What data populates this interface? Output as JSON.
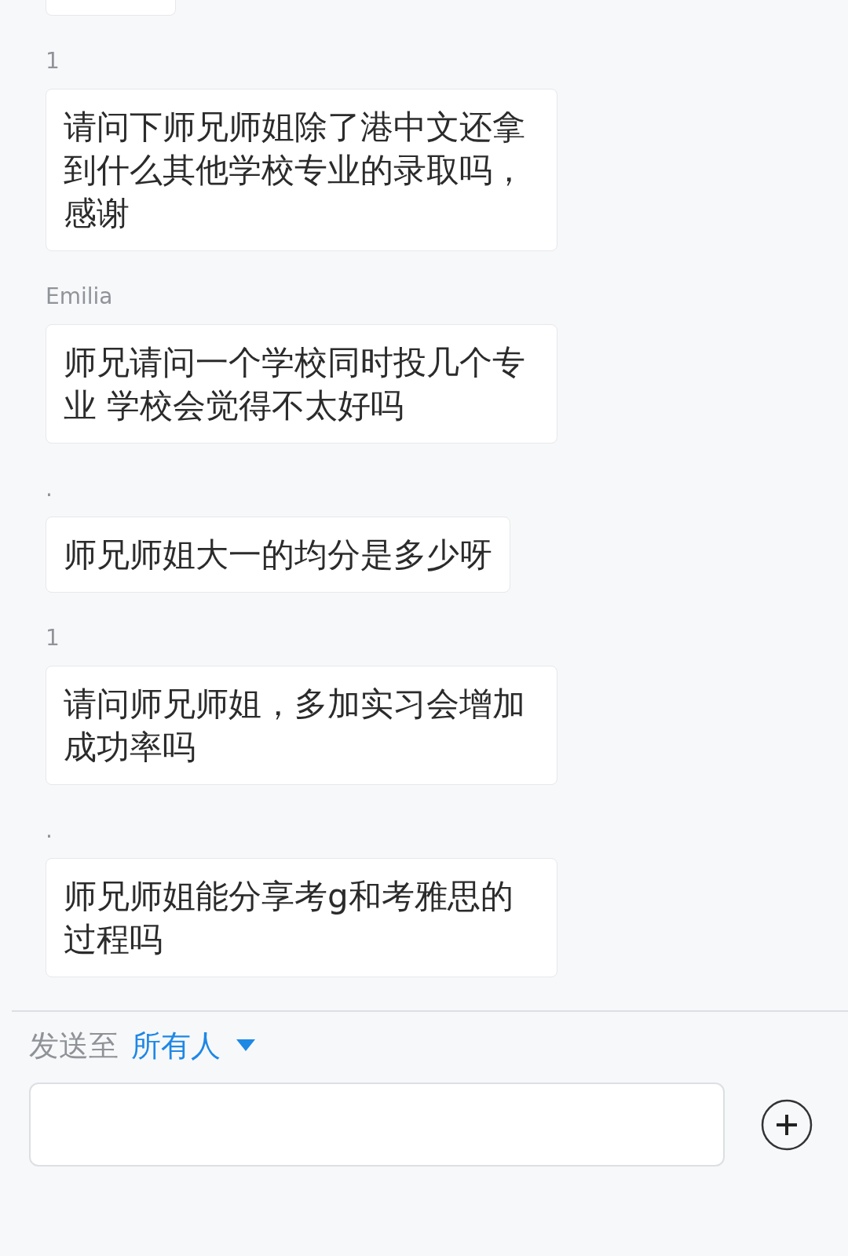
{
  "partial_message_above": true,
  "messages": [
    {
      "sender": "1",
      "text": "请问下师兄师姐除了港中文还拿到什么其他学校专业的录取吗，感谢"
    },
    {
      "sender": "Emilia",
      "text": "师兄请问一个学校同时投几个专业 学校会觉得不太好吗"
    },
    {
      "sender": ".",
      "text": "师兄师姐大一的均分是多少呀"
    },
    {
      "sender": "1",
      "text": "请问师兄师姐，多加实习会增加成功率吗"
    },
    {
      "sender": ".",
      "text": "师兄师姐能分享考g和考雅思的过程吗"
    }
  ],
  "composer": {
    "send_to_label": "发送至",
    "recipient": "所有人"
  }
}
